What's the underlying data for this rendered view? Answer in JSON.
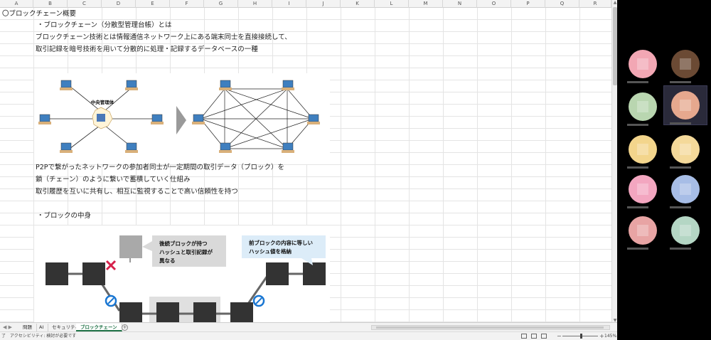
{
  "columns": [
    "A",
    "B",
    "C",
    "D",
    "E",
    "F",
    "G",
    "H",
    "I",
    "J",
    "K",
    "L",
    "M",
    "N",
    "O",
    "P",
    "Q",
    "R"
  ],
  "content": {
    "heading": "〇ブロックチェーン概要",
    "line1": "・ブロックチェーン（分散型管理台帳）とは",
    "line2": "ブロックチェーン技術とは情報通信ネットワーク上にある端末同士を直接接続して、",
    "line3": "取引記録を暗号技術を用いて分散的に処理・記録するデータベースの一種",
    "p2p1": "P2Pで繋がったネットワークの参加者同士が一定期間の取引データ（ブロック）を",
    "p2p2": "鎖（チェーン）のように繋いで蓄積していく仕組み",
    "p2p3": "取引履歴を互いに共有し、相互に監視することで高い信頼性を持つ",
    "block_heading": "・ブロックの中身"
  },
  "diagram1": {
    "center_label": "中央管理体"
  },
  "diagram2": {
    "callout_left": [
      "後続ブロックが持つ",
      "ハッシュと取引記録が",
      "異なる"
    ],
    "callout_right": [
      "前ブロックの内容に等しい",
      "ハッシュ値を格納"
    ]
  },
  "tabs": {
    "nav": "◀  ▶",
    "items": [
      {
        "label": "問題"
      },
      {
        "label": "AI"
      },
      {
        "label": "セキュリティ"
      },
      {
        "label": "ブロックチェーン"
      }
    ],
    "add": "+"
  },
  "status": {
    "ready": "了",
    "accessibility": "アクセシビリティ: 検討が必要です",
    "zoom": "145%",
    "zoom_percent": 145,
    "zoom_minus": "−",
    "zoom_plus": "+"
  },
  "colors": {
    "accent": "#1e7145",
    "callout_left_bg": "#d9d9d9",
    "callout_right_bg": "#dcecf8",
    "cross": "#d6204a",
    "check": "#1976d2",
    "block": "#333333"
  },
  "participants": [
    {
      "color": "#f2a7b4"
    },
    {
      "color": "#6b4a34"
    },
    {
      "color": "#b9d6b0"
    },
    {
      "color": "#e6a88e"
    },
    {
      "color": "#f3d58c"
    },
    {
      "color": "#f4d99a"
    },
    {
      "color": "#f3a6c0"
    },
    {
      "color": "#a7bde6"
    },
    {
      "color": "#e8a4a4"
    },
    {
      "color": "#b4d6c4"
    }
  ]
}
